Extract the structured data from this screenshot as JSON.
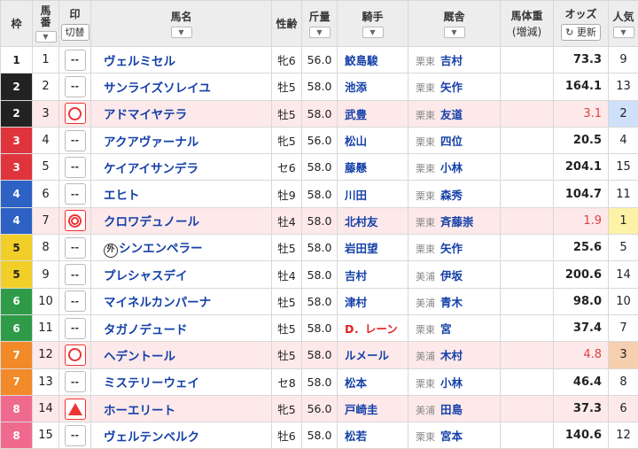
{
  "headers": {
    "waku": "枠",
    "umaban": "馬\n番",
    "umaban_line1": "馬",
    "umaban_line2": "番",
    "mark": "印",
    "mark_toggle": "切替",
    "horse": "馬名",
    "sex_age": "性齢",
    "weight": "斤量",
    "jockey": "騎手",
    "trainer": "厩舎",
    "body_weight": "馬体重",
    "body_weight_sub": "(増減)",
    "odds": "オッズ",
    "odds_refresh": "更新",
    "popularity": "人気",
    "sort_glyph": "▼"
  },
  "rows": [
    {
      "waku": "1",
      "umaban": "1",
      "mark": "--",
      "horse": "ヴェルミセル",
      "sex_age": "牝6",
      "weight": "56.0",
      "jockey": "鮫島駿",
      "aff": "栗東",
      "trainer": "吉村",
      "odds": "73.3",
      "pop": "9"
    },
    {
      "waku": "2",
      "umaban": "2",
      "mark": "--",
      "horse": "サンライズソレイユ",
      "sex_age": "牡5",
      "weight": "58.0",
      "jockey": "池添",
      "aff": "栗東",
      "trainer": "矢作",
      "odds": "164.1",
      "pop": "13"
    },
    {
      "waku": "2",
      "umaban": "3",
      "mark": "○",
      "horse": "アドマイヤテラ",
      "sex_age": "牡5",
      "weight": "58.0",
      "jockey": "武豊",
      "aff": "栗東",
      "trainer": "友道",
      "odds": "3.1",
      "pop": "2"
    },
    {
      "waku": "3",
      "umaban": "4",
      "mark": "--",
      "horse": "アクアヴァーナル",
      "sex_age": "牝5",
      "weight": "56.0",
      "jockey": "松山",
      "aff": "栗東",
      "trainer": "四位",
      "odds": "20.5",
      "pop": "4"
    },
    {
      "waku": "3",
      "umaban": "5",
      "mark": "--",
      "horse": "ケイアイサンデラ",
      "sex_age": "セ6",
      "weight": "58.0",
      "jockey": "藤懸",
      "aff": "栗東",
      "trainer": "小林",
      "odds": "204.1",
      "pop": "15"
    },
    {
      "waku": "4",
      "umaban": "6",
      "mark": "--",
      "horse": "エヒト",
      "sex_age": "牡9",
      "weight": "58.0",
      "jockey": "川田",
      "aff": "栗東",
      "trainer": "森秀",
      "odds": "104.7",
      "pop": "11"
    },
    {
      "waku": "4",
      "umaban": "7",
      "mark": "◎",
      "horse": "クロワデュノール",
      "sex_age": "牡4",
      "weight": "58.0",
      "jockey": "北村友",
      "aff": "栗東",
      "trainer": "斉藤崇",
      "odds": "1.9",
      "pop": "1"
    },
    {
      "waku": "5",
      "umaban": "8",
      "mark": "--",
      "horse": "シンエンペラー",
      "gai": "外",
      "sex_age": "牡5",
      "weight": "58.0",
      "jockey": "岩田望",
      "aff": "栗東",
      "trainer": "矢作",
      "odds": "25.6",
      "pop": "5"
    },
    {
      "waku": "5",
      "umaban": "9",
      "mark": "--",
      "horse": "プレシャスデイ",
      "sex_age": "牡4",
      "weight": "58.0",
      "jockey": "吉村",
      "aff": "美浦",
      "trainer": "伊坂",
      "odds": "200.6",
      "pop": "14"
    },
    {
      "waku": "6",
      "umaban": "10",
      "mark": "--",
      "horse": "マイネルカンパーナ",
      "sex_age": "牡5",
      "weight": "58.0",
      "jockey": "津村",
      "aff": "美浦",
      "trainer": "青木",
      "odds": "98.0",
      "pop": "10"
    },
    {
      "waku": "6",
      "umaban": "11",
      "mark": "--",
      "horse": "タガノデュード",
      "sex_age": "牡5",
      "weight": "58.0",
      "jockey": "D．レーン",
      "aff": "栗東",
      "trainer": "宮",
      "odds": "37.4",
      "pop": "7"
    },
    {
      "waku": "7",
      "umaban": "12",
      "mark": "○",
      "horse": "ヘデントール",
      "sex_age": "牡5",
      "weight": "58.0",
      "jockey": "ルメール",
      "aff": "美浦",
      "trainer": "木村",
      "odds": "4.8",
      "pop": "3"
    },
    {
      "waku": "7",
      "umaban": "13",
      "mark": "--",
      "horse": "ミステリーウェイ",
      "sex_age": "セ8",
      "weight": "58.0",
      "jockey": "松本",
      "aff": "栗東",
      "trainer": "小林",
      "odds": "46.4",
      "pop": "8"
    },
    {
      "waku": "8",
      "umaban": "14",
      "mark": "▲",
      "horse": "ホーエリート",
      "sex_age": "牝5",
      "weight": "56.0",
      "jockey": "戸崎圭",
      "aff": "美浦",
      "trainer": "田島",
      "odds": "37.3",
      "pop": "6"
    },
    {
      "waku": "8",
      "umaban": "15",
      "mark": "--",
      "horse": "ヴェルテンベルク",
      "sex_age": "牡6",
      "weight": "58.0",
      "jockey": "松若",
      "aff": "栗東",
      "trainer": "宮本",
      "odds": "140.6",
      "pop": "12"
    }
  ],
  "colors": {
    "link_blue": "#1540a8",
    "highlight_row": "#fde9ea",
    "mark_red": "#e33333",
    "pop1": "#fdf2a6",
    "pop2": "#cfe0fb",
    "pop3": "#f5cfae"
  }
}
